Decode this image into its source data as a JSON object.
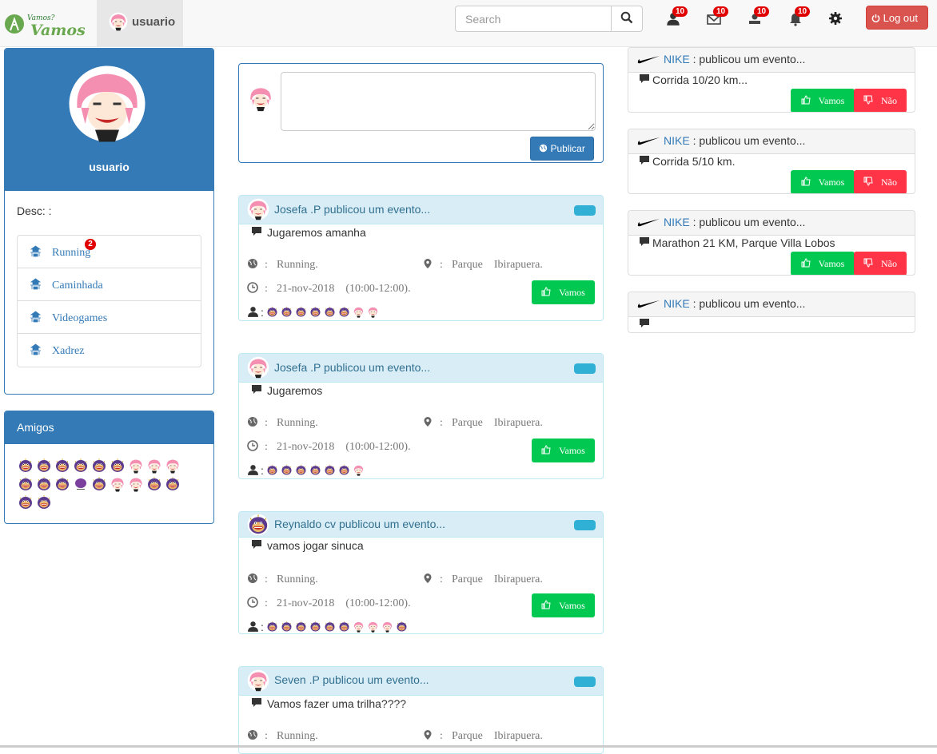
{
  "nav": {
    "brand_user": "usuario",
    "search_placeholder": "Search",
    "badges": [
      "10",
      "10",
      "10",
      "10"
    ],
    "logout_label": "Log out",
    "logo_text": "Vamos? Vamos!"
  },
  "profile": {
    "username": "usuario",
    "desc": "Desc: :",
    "categories": [
      {
        "label": "Running",
        "badge": "2"
      },
      {
        "label": "Caminhada"
      },
      {
        "label": "Videogames"
      },
      {
        "label": "Xadrez"
      }
    ]
  },
  "friends": {
    "title": "Amigos"
  },
  "composer": {
    "publish_label": "Publicar"
  },
  "posts": [
    {
      "author": "Josefa .P",
      "action": "publicou um evento...",
      "message": "Jugaremos amanha",
      "category": "Running.",
      "place": "Parque    Ibirapuera.",
      "date": "21-nov-2018    (10:00-12:00).",
      "vamos_label": "Vamos"
    },
    {
      "author": "Josefa .P",
      "action": "publicou um evento...",
      "message": "Jugaremos",
      "category": "Running.",
      "place": "Parque    Ibirapuera.",
      "date": "21-nov-2018    (10:00-12:00).",
      "vamos_label": "Vamos"
    },
    {
      "author": "Reynaldo cv",
      "action": "publicou um evento...",
      "message": "vamos jogar sinuca",
      "category": "Running.",
      "place": "Parque    Ibirapuera.",
      "date": "21-nov-2018    (10:00-12:00).",
      "vamos_label": "Vamos"
    },
    {
      "author": "Seven .P",
      "action": "publicou um evento...",
      "message": "Vamos fazer uma trilha????",
      "category": "Running.",
      "place": "Parque    Ibirapuera."
    }
  ],
  "nike_events": [
    {
      "brand": "NIKE",
      "action": ": publicou um evento...",
      "message": "Corrida 10/20 km...",
      "vamos_label": "Vamos",
      "nao_label": "Não"
    },
    {
      "brand": "NIKE",
      "action": ": publicou um evento...",
      "message": "Corrida 5/10 km.",
      "vamos_label": "Vamos",
      "nao_label": "Não"
    },
    {
      "brand": "NIKE",
      "action": ": publicou um evento...",
      "message": "Marathon 21 KM, Parque Villa Lobos",
      "vamos_label": "Vamos",
      "nao_label": "Não"
    },
    {
      "brand": "NIKE",
      "action": ": publicou um evento...",
      "message": ""
    }
  ]
}
